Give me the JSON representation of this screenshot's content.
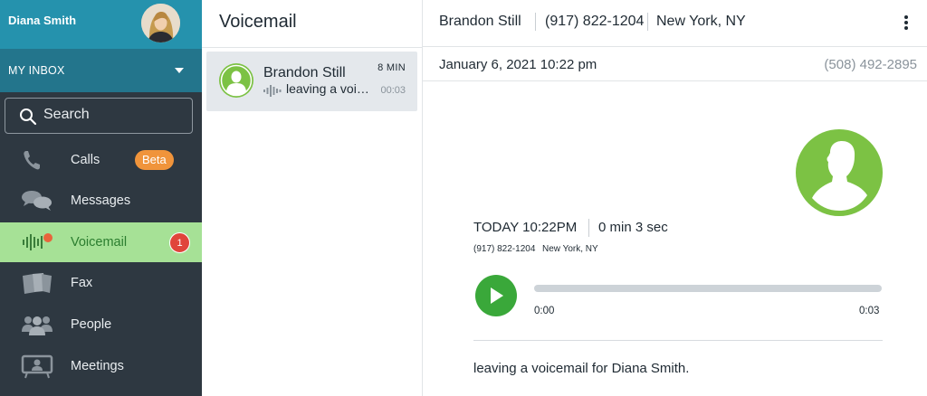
{
  "user": {
    "name": "Diana Smith"
  },
  "inbox": {
    "label": "MY INBOX"
  },
  "search": {
    "placeholder": "Search"
  },
  "nav": [
    {
      "label": "Calls",
      "icon": "phone-icon",
      "badge": "Beta"
    },
    {
      "label": "Messages",
      "icon": "chat-bubbles-icon"
    },
    {
      "label": "Voicemail",
      "icon": "voicemail-icon",
      "count": "1",
      "active": true
    },
    {
      "label": "Fax",
      "icon": "fax-icon"
    },
    {
      "label": "People",
      "icon": "people-icon"
    },
    {
      "label": "Meetings",
      "icon": "meetings-icon"
    }
  ],
  "list": {
    "title": "Voicemail",
    "items": [
      {
        "name": "Brandon Still",
        "age": "8 MIN",
        "preview": "leaving a voicemail for Diana Smith.",
        "duration": "00:03"
      }
    ]
  },
  "detail": {
    "contact_name": "Brandon Still",
    "contact_phone": "(917) 822-1204",
    "contact_location": "New York, NY",
    "date": "January 6, 2021 10:22 pm",
    "to_phone": "(508) 492-2895",
    "call_time": "TODAY 10:22PM",
    "call_length": "0 min 3 sec",
    "call_phone": "(917) 822-1204",
    "call_location": "New York, NY",
    "player": {
      "current": "0:00",
      "total": "0:03",
      "progress": 0
    },
    "transcript": "leaving a voicemail for Diana Smith."
  },
  "colors": {
    "accent_green": "#3aa83a",
    "avatar_green": "#7cc244",
    "sidebar": "#2e3841",
    "header_teal": "#2592ad",
    "beta_orange": "#f0943b",
    "count_red": "#e0453b"
  }
}
